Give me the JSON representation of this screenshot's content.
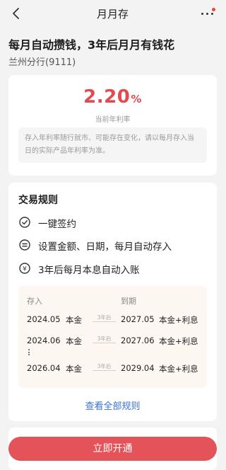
{
  "header": {
    "title": "月月存"
  },
  "headline": "每月自动攒钱，3年后月月有钱花",
  "branch": "兰州分行(9111)",
  "rate": {
    "value": "2.20",
    "unit": "%",
    "label": "当前年利率"
  },
  "notice": "存入年利率随行就市、可能存在变化，请以每月存入当日的实际产品年利率为准。",
  "rules": {
    "title": "交易规则",
    "items": [
      {
        "label": "一键签约",
        "icon": "check-circle-icon"
      },
      {
        "label": "设置金额、日期，每月自动存入",
        "icon": "equals-circle-icon"
      },
      {
        "label": "3年后每月本息自动入账",
        "icon": "yen-circle-icon"
      }
    ]
  },
  "timeline": {
    "head_left": "存入",
    "head_right": "到期",
    "arrow_label": "3年后",
    "rows": [
      {
        "start": "2024.05",
        "start_type": "本金",
        "end": "2027.05",
        "end_type": "本金+利息"
      },
      {
        "start": "2024.06",
        "start_type": "本金",
        "end": "2027.06",
        "end_type": "本金+利息"
      },
      {
        "start": "2026.04",
        "start_type": "本金",
        "end": "2029.04",
        "end_type": "本金+利息"
      }
    ]
  },
  "see_all": "查看全部规则",
  "cta": "立即开通",
  "colors": {
    "accent_red": "#e24a4f",
    "link_blue": "#3a72d8",
    "button_red": "#e5535a"
  }
}
